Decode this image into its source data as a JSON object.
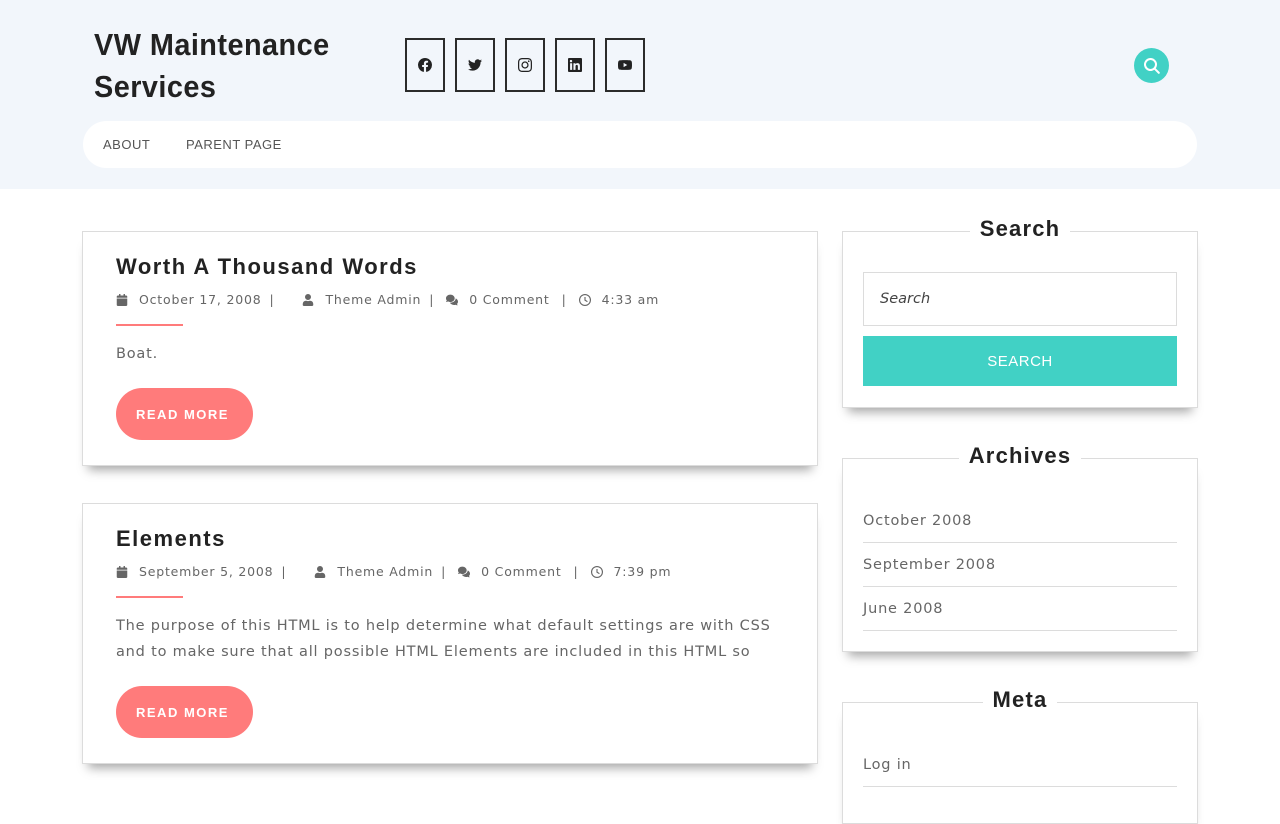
{
  "site": {
    "title": "VW Maintenance Services"
  },
  "socials": [
    {
      "icon": "facebook-icon"
    },
    {
      "icon": "twitter-icon"
    },
    {
      "icon": "instagram-icon"
    },
    {
      "icon": "linkedin-icon"
    },
    {
      "icon": "youtube-icon"
    }
  ],
  "nav": {
    "items": [
      "About",
      "Parent Page"
    ]
  },
  "posts": [
    {
      "title": "Worth A Thousand Words",
      "date": "October 17, 2008",
      "author": "Theme Admin",
      "comments": "0 Comment",
      "time": "4:33 am",
      "excerpt": "Boat.",
      "read_more": "READ MORE"
    },
    {
      "title": "Elements",
      "date": "September 5, 2008",
      "author": "Theme Admin",
      "comments": "0 Comment",
      "time": "7:39 pm",
      "excerpt": "The purpose of this HTML is to help determine what default settings are with CSS and to make sure that all possible HTML Elements are included in this HTML so",
      "read_more": "READ MORE"
    }
  ],
  "sidebar": {
    "search": {
      "title": "Search",
      "placeholder": "Search",
      "button": "Search"
    },
    "archives": {
      "title": "Archives",
      "items": [
        "October 2008",
        "September 2008",
        "June 2008"
      ]
    },
    "meta": {
      "title": "Meta",
      "items": [
        "Log in"
      ]
    }
  },
  "colors": {
    "accent_teal": "#41d1c5",
    "accent_coral": "#ff7b7b",
    "header_bg": "#f2f6fb"
  },
  "meta_separator": "|"
}
